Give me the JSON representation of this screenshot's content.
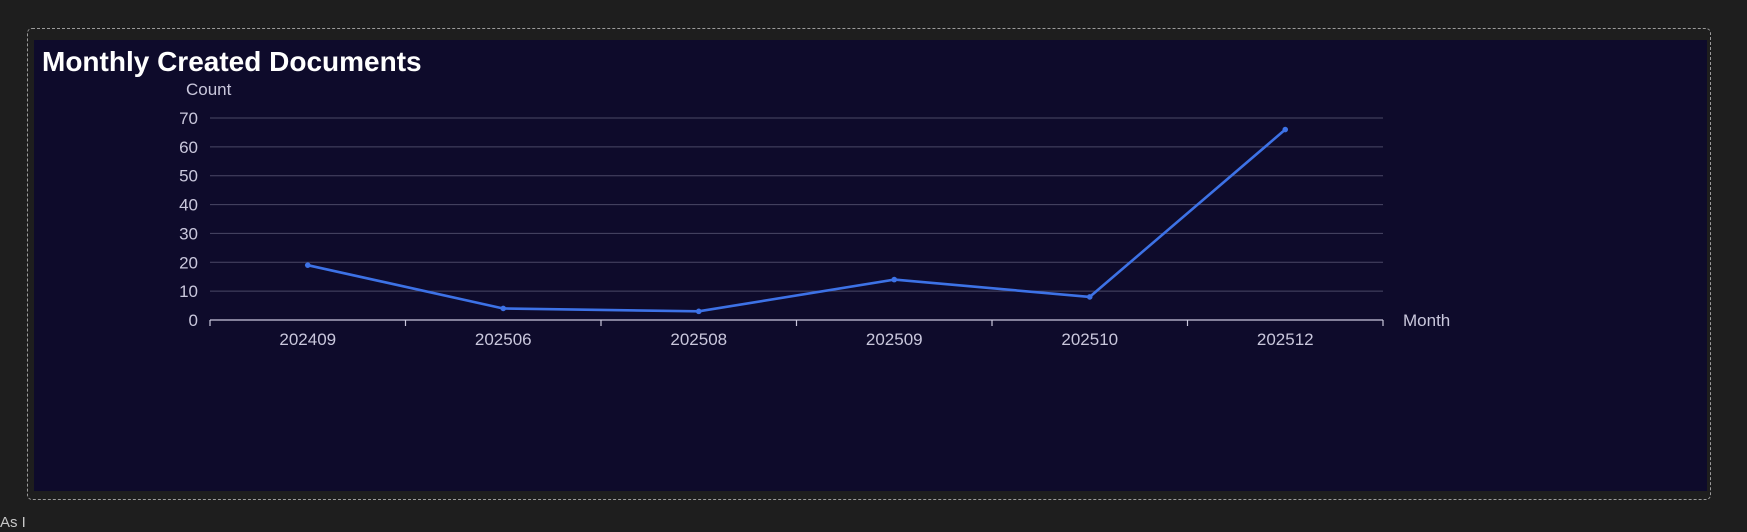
{
  "panel": {
    "title": "Monthly Created Documents"
  },
  "footer": {
    "partial_text": "As I"
  },
  "colors": {
    "page_background": "#1e1e1e",
    "panel_background": "#0e0b2b",
    "line": "#3d72e6",
    "grid": "#4a4866",
    "axis_text": "#c9c7dc"
  },
  "chart_data": {
    "type": "line",
    "title": "Monthly Created Documents",
    "xlabel": "Month",
    "ylabel": "Count",
    "categories": [
      "202409",
      "202506",
      "202508",
      "202509",
      "202510",
      "202512"
    ],
    "series": [
      {
        "values": [
          19,
          4,
          3,
          14,
          8,
          66
        ]
      }
    ],
    "ylim": [
      0,
      70
    ],
    "yticks": [
      0,
      10,
      20,
      30,
      40,
      50,
      60,
      70
    ],
    "grid": true,
    "legend": "none"
  }
}
